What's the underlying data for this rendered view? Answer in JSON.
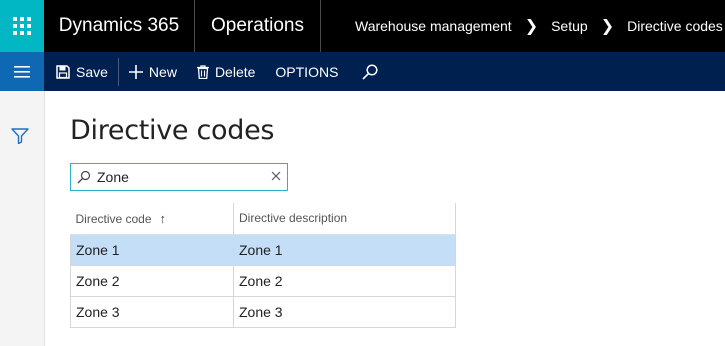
{
  "nav": {
    "app_name": "Dynamics 365",
    "module_name": "Operations",
    "breadcrumb": [
      "Warehouse management",
      "Setup",
      "Directive codes"
    ]
  },
  "actions": {
    "save": "Save",
    "new": "New",
    "delete": "Delete",
    "options": "OPTIONS"
  },
  "page": {
    "title": "Directive codes"
  },
  "search": {
    "value": "Zone"
  },
  "grid": {
    "columns": [
      "Directive code",
      "Directive description"
    ],
    "rows": [
      {
        "code": "Zone 1",
        "description": "Zone 1",
        "selected": true
      },
      {
        "code": "Zone 2",
        "description": "Zone 2",
        "selected": false
      },
      {
        "code": "Zone 3",
        "description": "Zone 3",
        "selected": false
      }
    ]
  },
  "colors": {
    "topbar": "#000000",
    "waffle": "#00b7c3",
    "actionbar": "#002050",
    "hamburger": "#0f68b4",
    "selected_row": "#c5def7",
    "search_border": "#2cb2c6"
  },
  "icons": {
    "waffle": "app-launcher-icon",
    "menu": "hamburger-icon",
    "save": "save-icon",
    "new": "plus-icon",
    "delete": "trash-icon",
    "search": "search-icon",
    "filter": "filter-icon",
    "clear": "close-icon",
    "sort": "sort-ascending-icon"
  }
}
